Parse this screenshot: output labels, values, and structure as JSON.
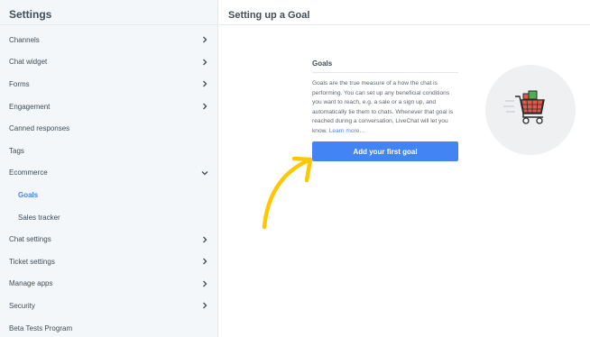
{
  "sidebar": {
    "title": "Settings",
    "items": [
      {
        "label": "Channels",
        "chevron": "chevron-right"
      },
      {
        "label": "Chat widget",
        "chevron": "chevron-right"
      },
      {
        "label": "Forms",
        "chevron": "chevron-right"
      },
      {
        "label": "Engagement",
        "chevron": "chevron-right"
      },
      {
        "label": "Canned responses",
        "chevron": ""
      },
      {
        "label": "Tags",
        "chevron": ""
      },
      {
        "label": "Ecommerce",
        "chevron": "chevron-down"
      },
      {
        "label": "Goals",
        "chevron": "",
        "active": true
      },
      {
        "label": "Sales tracker",
        "chevron": ""
      },
      {
        "label": "Chat settings",
        "chevron": "chevron-right"
      },
      {
        "label": "Ticket settings",
        "chevron": "chevron-right"
      },
      {
        "label": "Manage apps",
        "chevron": "chevron-right"
      },
      {
        "label": "Security",
        "chevron": "chevron-right"
      },
      {
        "label": "Beta Tests Program",
        "chevron": ""
      }
    ]
  },
  "main": {
    "title": "Setting up a Goal",
    "card": {
      "title": "Goals",
      "text": "Goals are the true measure of a how the chat is performing. You can set up any beneficial conditions you want to reach, e.g. a sale or a sign up, and automatically tie them to chats. Whenever that goal is reached during a conversation, LiveChat will let you know.",
      "link": "Learn more…",
      "button": "Add your first goal"
    },
    "illustration": "shopping-cart-icon"
  },
  "colors": {
    "accent": "#4384f5",
    "sidebar_bg": "#f3f7f9",
    "arrow": "#ffc700"
  }
}
